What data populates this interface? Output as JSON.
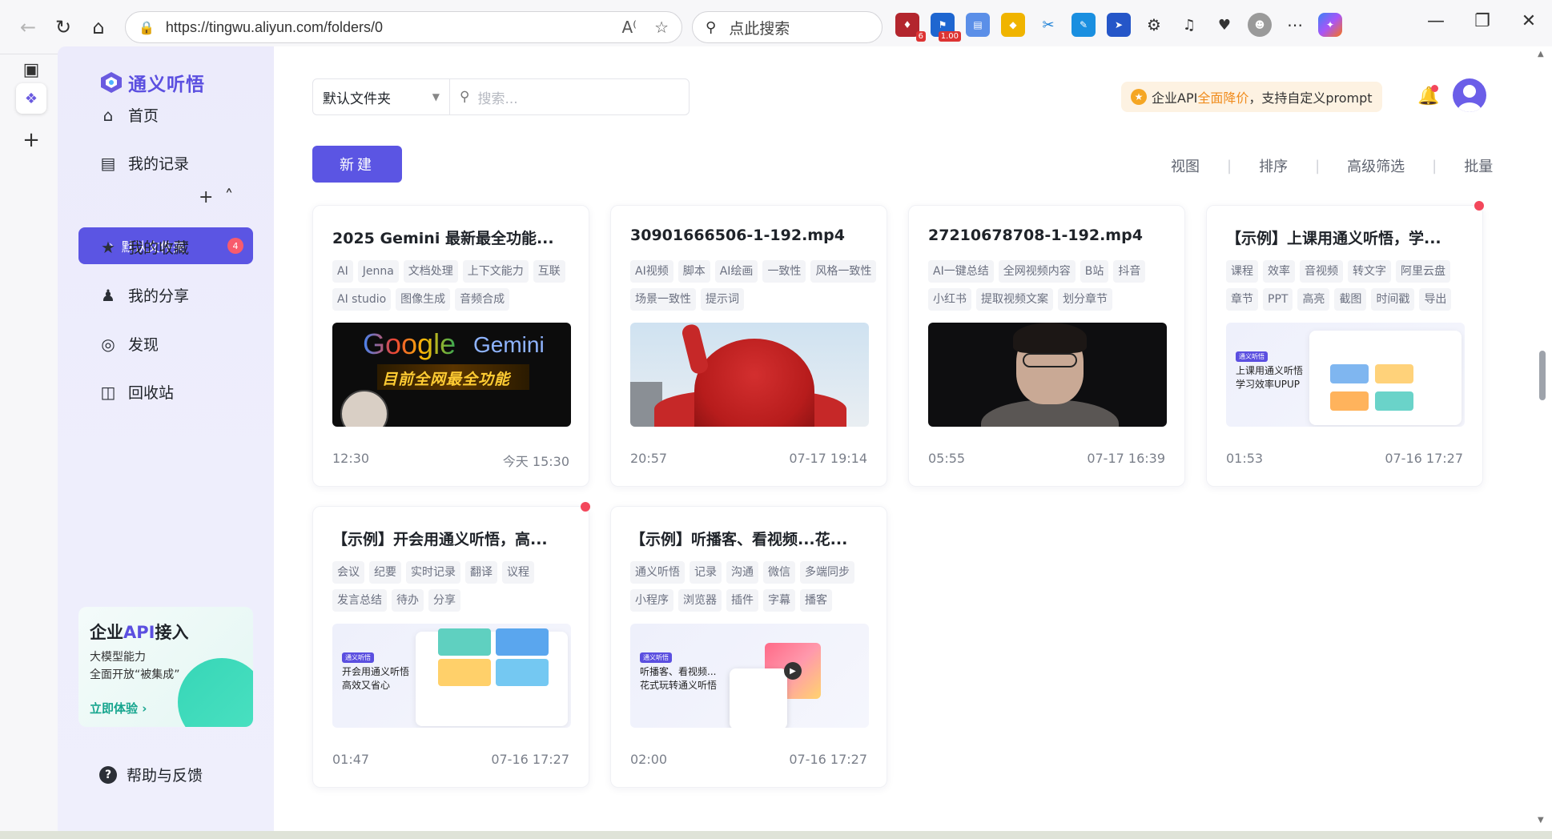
{
  "browser": {
    "url": "https://tingwu.aliyun.com/folders/0",
    "search_placeholder": "点此搜索",
    "ext_badge_1": "6",
    "ext_badge_2": "1.00"
  },
  "sidebar": {
    "logo_text": "通义听悟",
    "items": [
      {
        "label": "首页",
        "icon": "home-icon"
      },
      {
        "label": "我的记录",
        "icon": "document-icon"
      },
      {
        "label": "我的收藏",
        "icon": "star-icon"
      },
      {
        "label": "我的分享",
        "icon": "users-icon"
      },
      {
        "label": "发现",
        "icon": "discover-icon"
      },
      {
        "label": "回收站",
        "icon": "trash-icon"
      }
    ],
    "folder": {
      "label": "默认文件夹",
      "count": "4"
    },
    "api_card": {
      "title_prefix": "企业",
      "title_api": "API",
      "title_suffix": "接入",
      "line1": "大模型能力",
      "line2": "全面开放“被集成”",
      "cta": "立即体验"
    },
    "help": "帮助与反馈"
  },
  "header": {
    "folder_select": "默认文件夹",
    "search_placeholder": "搜索...",
    "promo_prefix": "企业API",
    "promo_highlight": "全面降价",
    "promo_suffix": "，支持自定义prompt",
    "new_button": "新建"
  },
  "toolbar": [
    "视图",
    "排序",
    "高级筛选",
    "批量"
  ],
  "cards": [
    {
      "title": "2025 Gemini 最新最全功能...",
      "tags": [
        "AI",
        "Jenna",
        "文档处理",
        "上下文能力",
        "互联",
        "AI studio",
        "图像生成",
        "音频合成"
      ],
      "thumb_text_1": "Google",
      "thumb_text_2": "Gemini",
      "thumb_text_3": "目前全网最全功能",
      "duration": "12:30",
      "date": "今天 15:30"
    },
    {
      "title": "30901666506-1-192.mp4",
      "tags": [
        "AI视频",
        "脚本",
        "AI绘画",
        "一致性",
        "风格一致性",
        "场景一致性",
        "提示词"
      ],
      "duration": "20:57",
      "date": "07-17 19:14"
    },
    {
      "title": "27210678708-1-192.mp4",
      "tags": [
        "AI一键总结",
        "全网视频内容",
        "B站",
        "抖音",
        "小红书",
        "提取视频文案",
        "划分章节"
      ],
      "duration": "05:55",
      "date": "07-17 16:39"
    },
    {
      "title": "【示例】上课用通义听悟，学...",
      "tags": [
        "课程",
        "效率",
        "音视频",
        "转文字",
        "阿里云盘",
        "章节",
        "PPT",
        "高亮",
        "截图",
        "时间戳",
        "导出"
      ],
      "thumb_label": "通义听悟",
      "thumb_line1": "上课用通义听悟",
      "thumb_line2": "学习效率UPUP",
      "duration": "01:53",
      "date": "07-16 17:27"
    },
    {
      "title": "【示例】开会用通义听悟，高...",
      "tags": [
        "会议",
        "纪要",
        "实时记录",
        "翻译",
        "议程",
        "发言总结",
        "待办",
        "分享"
      ],
      "thumb_label": "通义听悟",
      "thumb_line1": "开会用通义听悟",
      "thumb_line2": "高效又省心",
      "duration": "01:47",
      "date": "07-16 17:27"
    },
    {
      "title": "【示例】听播客、看视频...花...",
      "tags": [
        "通义听悟",
        "记录",
        "沟通",
        "微信",
        "多端同步",
        "小程序",
        "浏览器",
        "插件",
        "字幕",
        "播客"
      ],
      "thumb_label": "通义听悟",
      "thumb_line1": "听播客、看视频...",
      "thumb_line2": "花式玩转通义听悟",
      "duration": "02:00",
      "date": "07-16 17:27"
    }
  ],
  "colors": {
    "accent": "#5b55e3",
    "unread_dot": "#f3475b",
    "promo_highlight": "#f08c1d",
    "api_cta": "#16a58e"
  }
}
